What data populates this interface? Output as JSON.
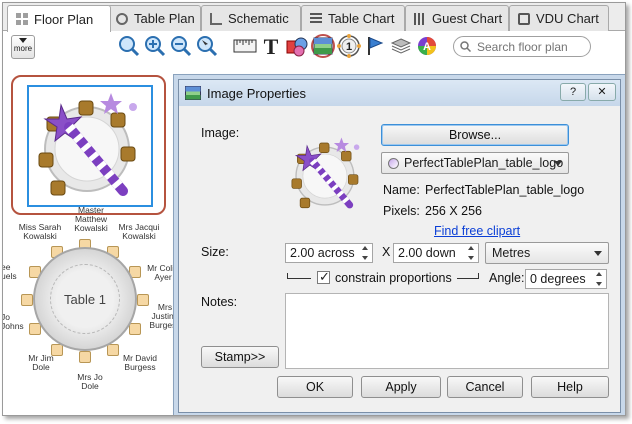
{
  "tabs": [
    {
      "label": "Floor Plan",
      "icon": "grid-icon",
      "active": true
    },
    {
      "label": "Table Plan",
      "icon": "circle-icon"
    },
    {
      "label": "Schematic",
      "icon": "schematic-icon"
    },
    {
      "label": "Table Chart",
      "icon": "chart-icon"
    },
    {
      "label": "Guest Chart",
      "icon": "guest-chart-icon"
    },
    {
      "label": "VDU Chart",
      "icon": "vdu-icon"
    }
  ],
  "toolbar": {
    "more_label": "more",
    "tools": [
      "zoom-fit-icon",
      "zoom-in-icon",
      "zoom-out-icon",
      "zoom-select-icon",
      "ruler-icon",
      "text-icon",
      "shapes-icon",
      "image-icon",
      "table-number-icon",
      "flag-icon",
      "layers-icon",
      "color-wheel-icon"
    ],
    "search_placeholder": "Search floor plan"
  },
  "floor": {
    "table_label": "Table 1",
    "guests": [
      {
        "name": "Master\nMatthew\nKowalski"
      },
      {
        "name": "Miss Sarah\nKowalski"
      },
      {
        "name": "Mrs Jacqui\nKowalski"
      },
      {
        "name": "Mr Colin\nAyer"
      },
      {
        "name": "Mrs\nJustine\nBurgess"
      },
      {
        "name": "Mr David\nBurgess"
      },
      {
        "name": "Mrs Jo\nDole"
      },
      {
        "name": "Mr Jim\nDole"
      },
      {
        "name": "Jo\nJohns"
      },
      {
        "name": "ee\nuels"
      }
    ]
  },
  "dialog": {
    "title": "Image Properties",
    "help_label": "?",
    "close_label": "✕",
    "image_label": "Image:",
    "browse_label": "Browse...",
    "image_select": "PerfectTablePlan_table_logo",
    "name_label": "Name:",
    "name_value": "PerfectTablePlan_table_logo",
    "pixels_label": "Pixels:",
    "pixels_value": "256 X 256",
    "find_clipart": "Find free clipart",
    "size_label": "Size:",
    "across_value": "2.00 across",
    "x_label": "X",
    "down_value": "2.00 down",
    "unit_value": "Metres",
    "constrain_label": "constrain proportions",
    "angle_label": "Angle:",
    "angle_value": "0 degrees",
    "notes_label": "Notes:",
    "stamp_label": "Stamp>>",
    "ok_label": "OK",
    "apply_label": "Apply",
    "cancel_label": "Cancel",
    "help_button_label": "Help"
  }
}
